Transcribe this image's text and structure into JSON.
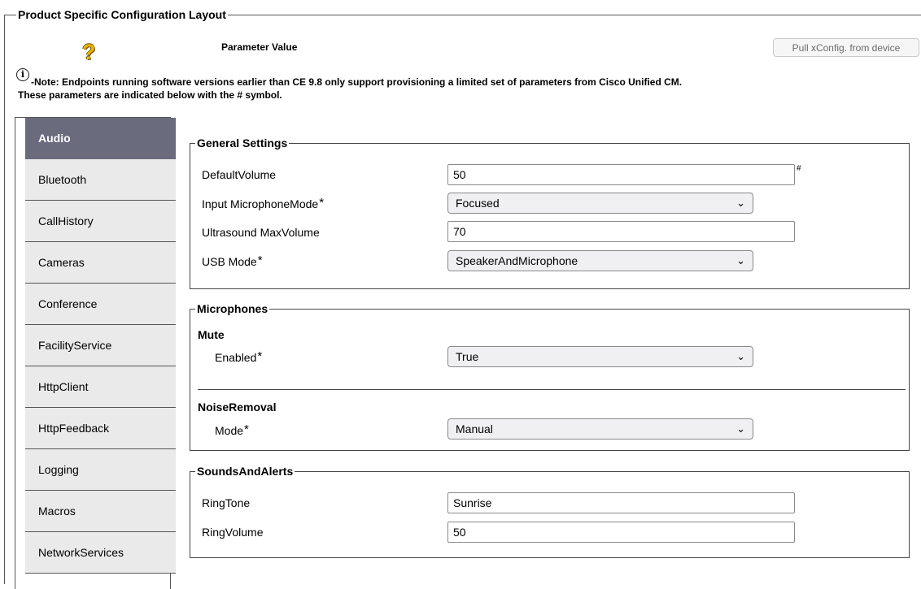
{
  "page": {
    "frame_title": "Product Specific Configuration Layout",
    "help_icon_glyph": "?",
    "param_header": "Parameter Value",
    "pull_button": "Pull xConfig. from device",
    "note_icon_glyph": "i",
    "note_line1": "-Note: Endpoints running software versions earlier than CE 9.8 only support provisioning a limited set of parameters from Cisco Unified CM.",
    "note_line2": "These parameters are indicated below with the # symbol."
  },
  "tabs": [
    {
      "label": "Audio",
      "active": true
    },
    {
      "label": "Bluetooth"
    },
    {
      "label": "CallHistory"
    },
    {
      "label": "Cameras"
    },
    {
      "label": "Conference"
    },
    {
      "label": "FacilityService"
    },
    {
      "label": "HttpClient"
    },
    {
      "label": "HttpFeedback"
    },
    {
      "label": "Logging"
    },
    {
      "label": "Macros"
    },
    {
      "label": "NetworkServices"
    }
  ],
  "general": {
    "title": "General Settings",
    "default_volume": {
      "label": "DefaultVolume",
      "value": "50",
      "mark": "#"
    },
    "mic_mode": {
      "label": "Input MicrophoneMode",
      "star": "*",
      "value": "Focused"
    },
    "ultrasound": {
      "label": "Ultrasound MaxVolume",
      "value": "70"
    },
    "usb_mode": {
      "label": "USB Mode",
      "star": "*",
      "value": "SpeakerAndMicrophone"
    }
  },
  "microphones": {
    "title": "Microphones",
    "mute_heading": "Mute",
    "enabled": {
      "label": "Enabled",
      "star": "*",
      "value": "True"
    },
    "noise_heading": "NoiseRemoval",
    "mode": {
      "label": "Mode",
      "star": "*",
      "value": "Manual"
    }
  },
  "sounds": {
    "title": "SoundsAndAlerts",
    "ringtone": {
      "label": "RingTone",
      "value": "Sunrise"
    },
    "ringvolume": {
      "label": "RingVolume",
      "value": "50"
    }
  },
  "icons": {
    "chevron": "⌄"
  },
  "colors": {
    "active_tab": "#6a6b7d",
    "tab_bg": "#eaeaea",
    "select_bg": "#f0eff2",
    "help_icon": "#e8b400"
  }
}
